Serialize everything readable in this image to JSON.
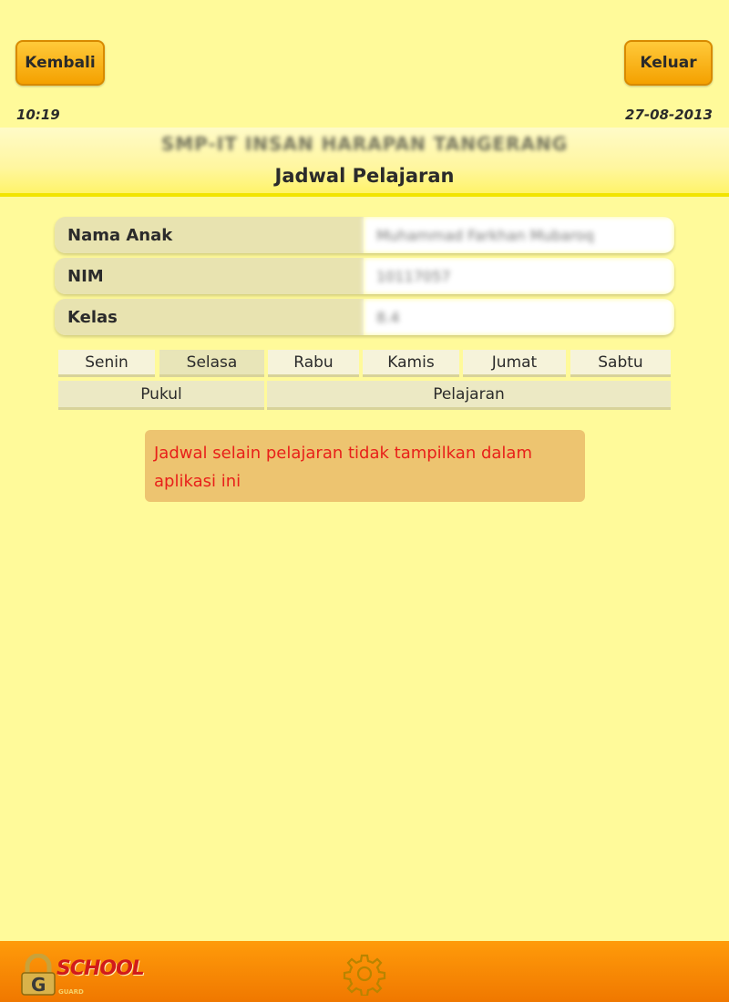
{
  "nav": {
    "back_label": "Kembali",
    "logout_label": "Keluar"
  },
  "status": {
    "time": "10:19",
    "date": "27-08-2013"
  },
  "header": {
    "school_name": "SMP-IT INSAN HARAPAN TANGERANG",
    "title": "Jadwal Pelajaran"
  },
  "student": {
    "name_label": "Nama Anak",
    "name_value": "Muhammad Farkhan Mubaroq",
    "nim_label": "NIM",
    "nim_value": "10117057",
    "class_label": "Kelas",
    "class_value": "8.4"
  },
  "days": [
    "Senin",
    "Selasa",
    "Rabu",
    "Kamis",
    "Jumat",
    "Sabtu"
  ],
  "active_day": "Selasa",
  "table": {
    "col_time": "Pukul",
    "col_subject": "Pelajaran"
  },
  "notice": "Jadwal selain pelajaran tidak tampilkan dalam aplikasi ini",
  "footer": {
    "logo_text": "SCHOOL",
    "logo_letter": "G",
    "logo_subtext": "GUARD"
  },
  "icons": {
    "settings": "gear-icon",
    "logo": "padlock-logo-icon"
  },
  "colors": {
    "background": "#fffa9a",
    "button": "#f4a100",
    "footer": "#f07800",
    "notice_bg": "#edc470",
    "notice_text": "#e8201a"
  }
}
